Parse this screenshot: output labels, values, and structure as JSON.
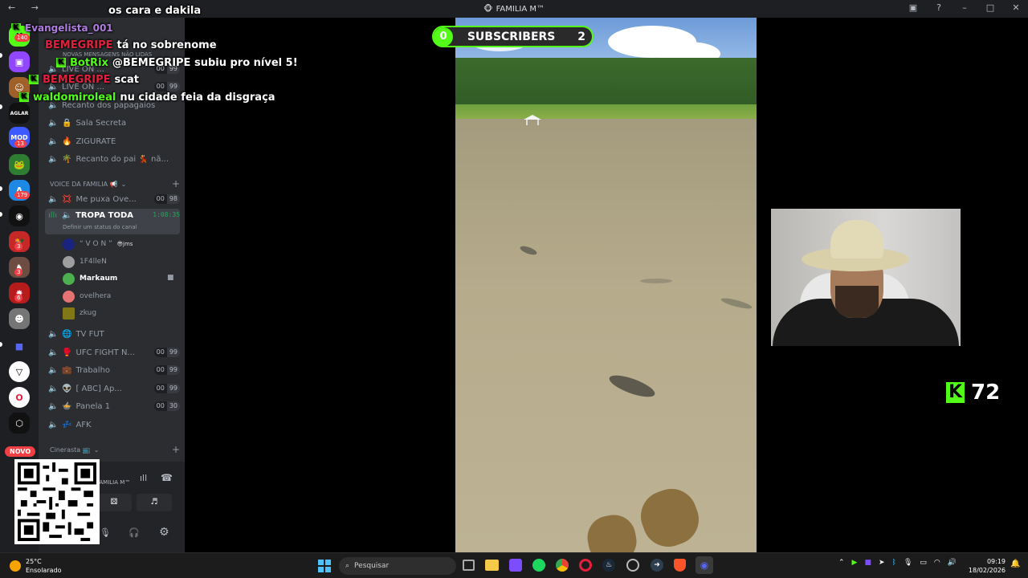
{
  "window": {
    "title": "FAMILIA M™",
    "nav": "← →"
  },
  "rail": {
    "badges": [
      "140",
      "13",
      "179",
      "3",
      "3",
      "6"
    ],
    "novo": "NOVO"
  },
  "channels": {
    "unread_banner": "NOVAS MENSAGENS NÃO LIDAS",
    "items_top": [
      {
        "label": "LIVE ON ...",
        "c1": "00",
        "c2": "99"
      },
      {
        "label": "LIVE ON ...",
        "c1": "00",
        "c2": "99"
      },
      {
        "label": "Recanto dos papagaios"
      },
      {
        "label": "Sala Secreta"
      },
      {
        "label": "ZIGURATE"
      },
      {
        "label": "Recanto do pai 💃 nã..."
      }
    ],
    "category_voice": "VOICE DA FAMILIA 📢",
    "voice_items": [
      {
        "label": "Me puxa Ove...",
        "c1": "00",
        "c2": "98"
      }
    ],
    "active_channel": {
      "label": "TROPA TODA",
      "timer": "1:08:35",
      "status": "Definir um status do canal"
    },
    "voice_users": [
      {
        "name": "“ V O N ”",
        "tag": "😎jms"
      },
      {
        "name": "1F4lleN"
      },
      {
        "name": "Markaum"
      },
      {
        "name": "ovelhera"
      },
      {
        "name": "zkug"
      }
    ],
    "items_bottom": [
      {
        "label": "TV FUT"
      },
      {
        "label": "UFC FIGHT N...",
        "c1": "00",
        "c2": "99"
      },
      {
        "label": "Trabalho",
        "c1": "00",
        "c2": "99"
      },
      {
        "label": "[ ABC] Ap...",
        "c1": "00",
        "c2": "99"
      },
      {
        "label": "Panela 1",
        "c1": "00",
        "c2": "30"
      },
      {
        "label": "AFK"
      }
    ],
    "category_cine": "Cinerasta 📺",
    "panel_server": "FAMILIA M™"
  },
  "chat": [
    {
      "user": "",
      "msg": "os cara e dakila",
      "color": "#ffffff"
    },
    {
      "user": "Evangelista_001",
      "msg": "",
      "color": "#b07ee0"
    },
    {
      "user": "BEMEGRIPE",
      "msg": "tá no sobrenome",
      "color": "#e0203c"
    },
    {
      "user": "BotRix",
      "msg": "@BEMEGRIPE subiu pro nível 5!",
      "color": "#53fc18"
    },
    {
      "user": "BEMEGRIPE",
      "msg": "scat",
      "color": "#e0203c"
    },
    {
      "user": "waldomiroleal",
      "msg": "nu cidade feia da disgraça",
      "color": "#53fc18"
    }
  ],
  "subscribers": {
    "label": "SUBSCRIBERS",
    "left": "0",
    "right": "2"
  },
  "kick_count": "72",
  "taskbar": {
    "weather_temp": "25°C",
    "weather_desc": "Ensolarado",
    "search": "Pesquisar",
    "time": "09:19",
    "date": "18/02/2026"
  },
  "colors": {
    "kick_green": "#53fc18",
    "discord_bg": "#2b2d31",
    "rail_bg": "#1e1f22",
    "badge_red": "#f23f43"
  }
}
